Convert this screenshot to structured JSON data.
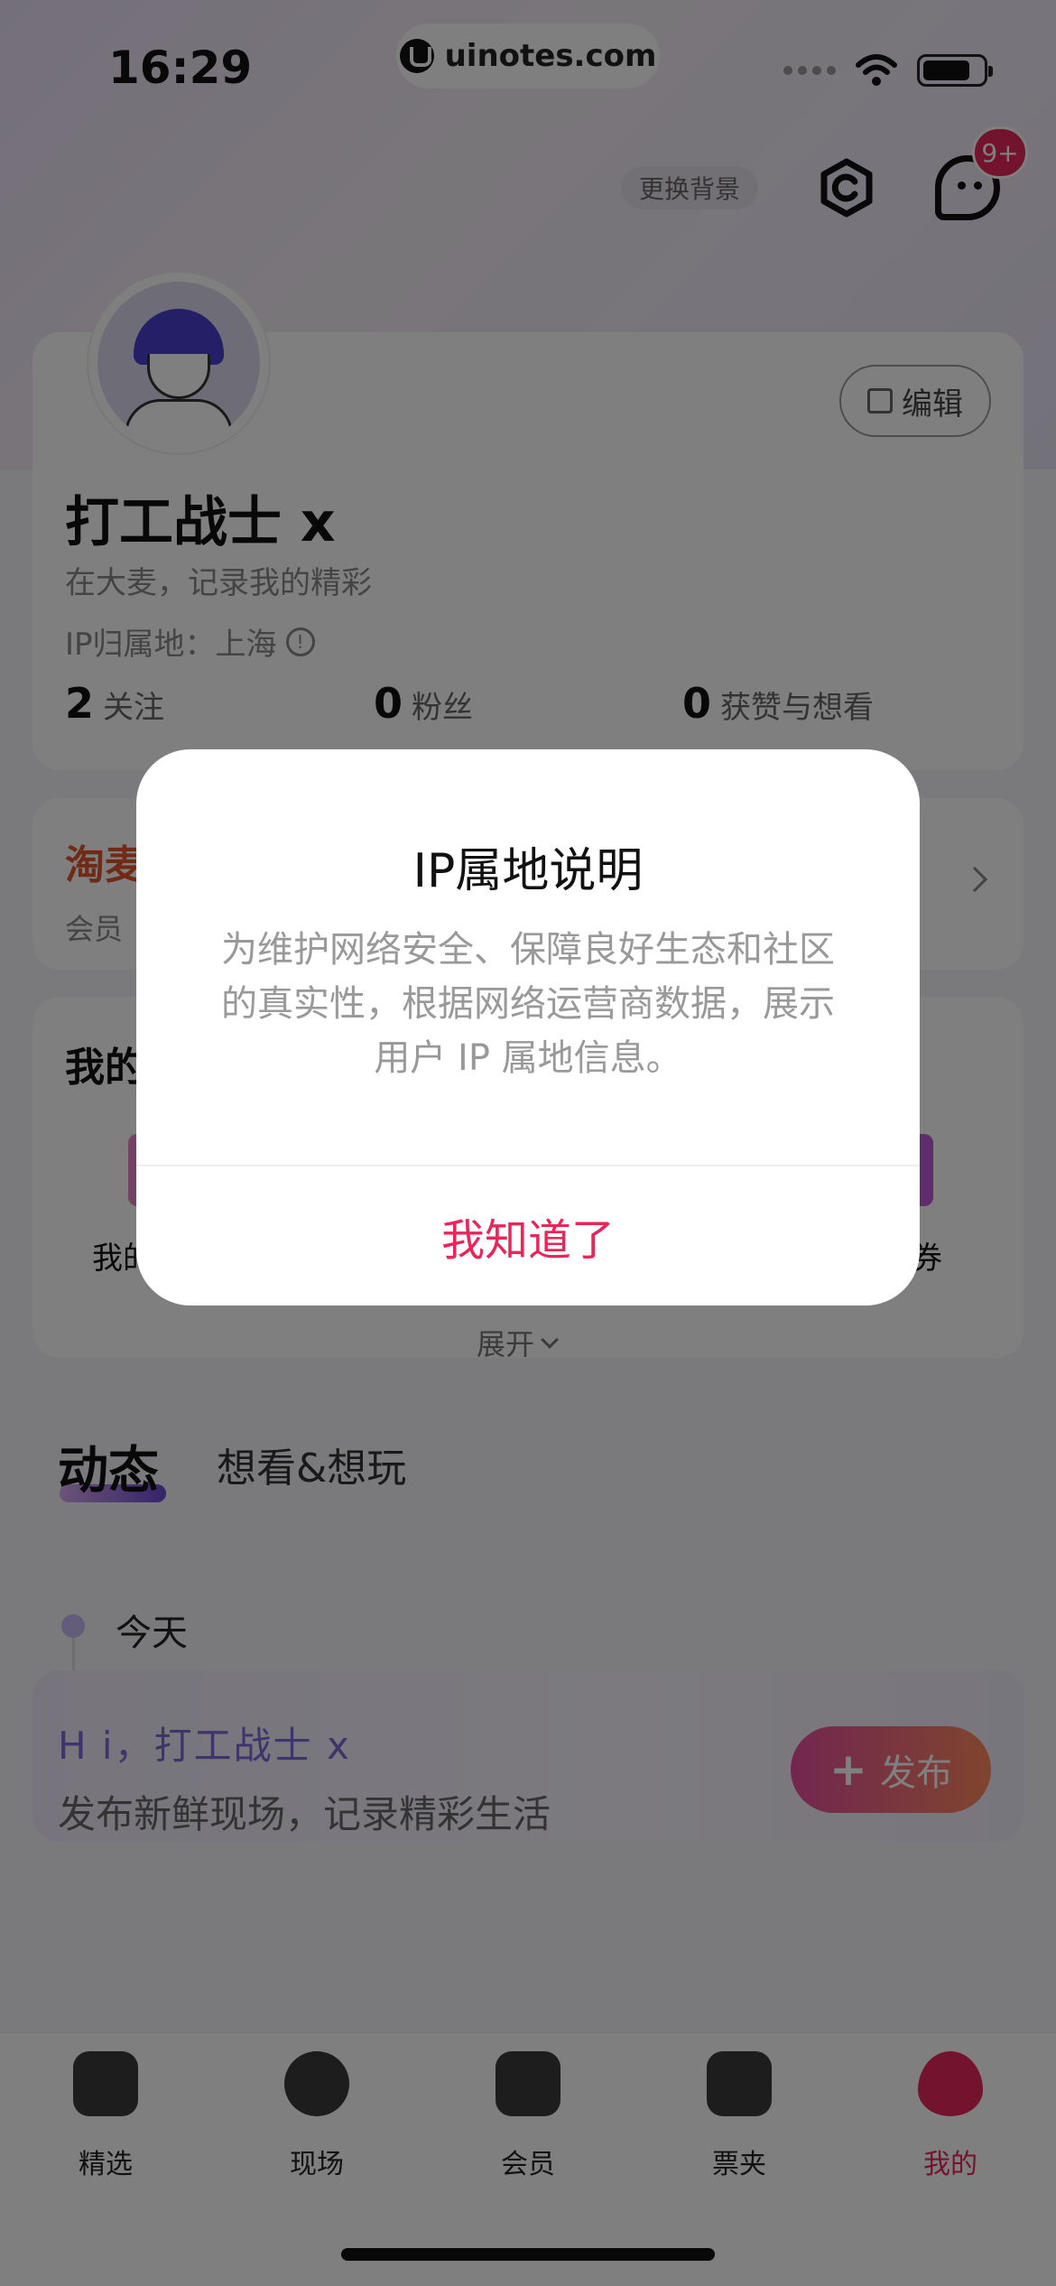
{
  "status_bar": {
    "time": "16:29",
    "url": "uinotes.com"
  },
  "header": {
    "change_bg_label": "更换背景",
    "message_badge": "9+"
  },
  "profile": {
    "name": "打工战士 x",
    "bio": "在大麦，记录我的精彩",
    "ip_label": "IP归属地：上海",
    "edit_label": "编辑",
    "stats": [
      {
        "count": "2",
        "label": "关注"
      },
      {
        "count": "0",
        "label": "粉丝"
      },
      {
        "count": "0",
        "label": "获赞与想看"
      }
    ]
  },
  "member": {
    "brand": "淘麦",
    "sub": "会员"
  },
  "my_section": {
    "title": "我的",
    "left_label": "我的",
    "right_label": "券",
    "expand_label": "展开"
  },
  "tabs": {
    "active": "动态",
    "second": "想看&想玩"
  },
  "timeline": {
    "label": "今天"
  },
  "post": {
    "greeting": "H i，打工战士 x",
    "subtitle": "发布新鲜现场，记录精彩生活",
    "publish_label": "发布"
  },
  "nav": [
    {
      "label": "精选"
    },
    {
      "label": "现场"
    },
    {
      "label": "会员"
    },
    {
      "label": "票夹"
    },
    {
      "label": "我的"
    }
  ],
  "modal": {
    "title": "IP属地说明",
    "body": "为维护网络安全、保障良好生态和社区的真实性，根据网络运营商数据，展示用户 IP 属地信息。",
    "confirm": "我知道了"
  },
  "colors": {
    "accent": "#e8265a",
    "brand_orange": "#e0572c"
  }
}
